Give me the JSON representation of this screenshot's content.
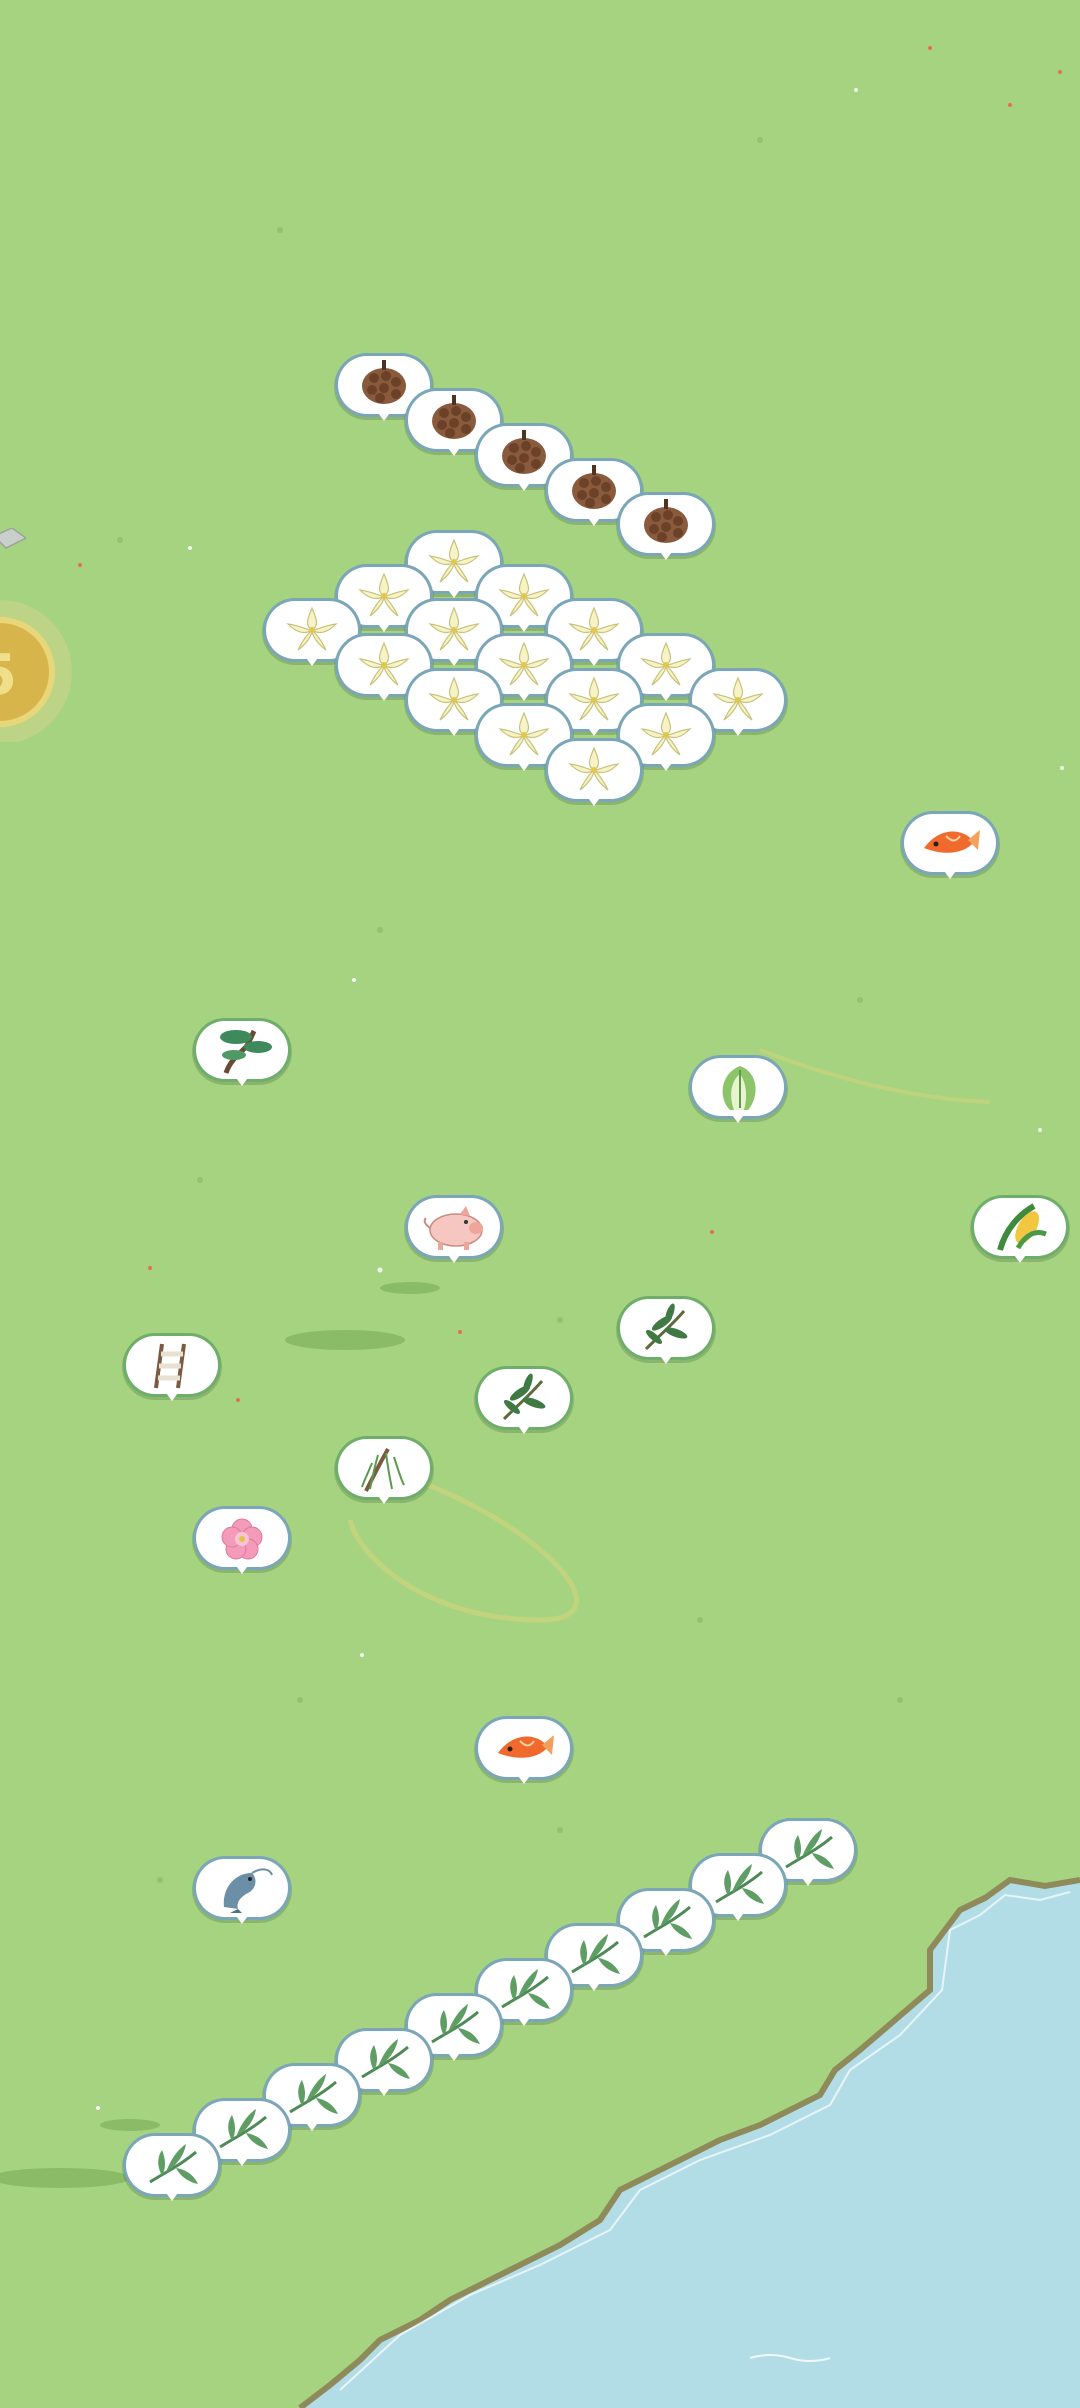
{
  "scene": {
    "grass_color": "#a6d380",
    "water_color": "#b2dde6",
    "shore_color": "#8f8a5a",
    "bubble_border": "#7aa6b8"
  },
  "resources": [
    {
      "type": "pinecone",
      "icon": "pinecone-icon"
    },
    {
      "type": "lily",
      "icon": "white-lily-icon"
    },
    {
      "type": "koi",
      "icon": "koi-fish-icon"
    },
    {
      "type": "pine-tree",
      "icon": "pine-tree-icon"
    },
    {
      "type": "cabbage",
      "icon": "cabbage-icon"
    },
    {
      "type": "pig",
      "icon": "pig-icon"
    },
    {
      "type": "corn",
      "icon": "corn-icon"
    },
    {
      "type": "ladder",
      "icon": "ladder-icon"
    },
    {
      "type": "bamboo",
      "icon": "bamboo-branch-icon"
    },
    {
      "type": "willow",
      "icon": "willow-tree-icon"
    },
    {
      "type": "peony",
      "icon": "peony-flower-icon"
    },
    {
      "type": "shrimp",
      "icon": "shrimp-icon"
    },
    {
      "type": "reed",
      "icon": "reed-leaf-icon"
    }
  ]
}
